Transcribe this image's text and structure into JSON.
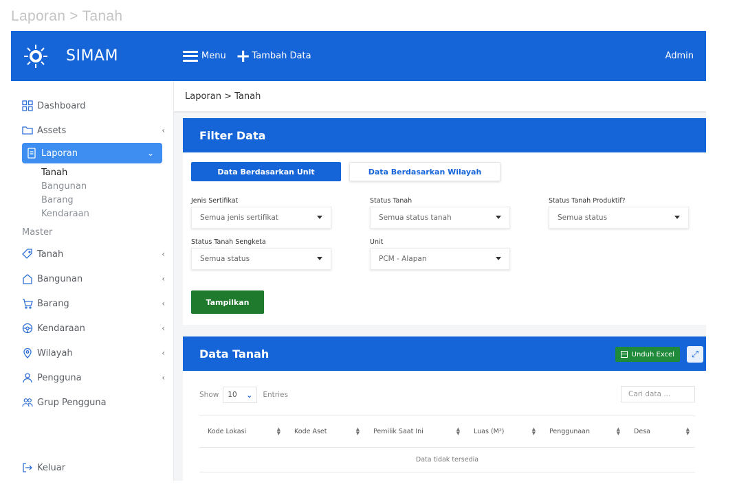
{
  "page_caption": "Laporan > Tanah",
  "brand": {
    "name": "SIMAM"
  },
  "topbar": {
    "menu_label": "Menu",
    "add_label": "Tambah Data",
    "user": "Admin"
  },
  "sidebar": {
    "items": [
      {
        "label": "Dashboard",
        "icon": "dashboard-icon"
      },
      {
        "label": "Assets",
        "icon": "folder-icon",
        "chevron": "‹"
      },
      {
        "label": "Laporan",
        "icon": "document-icon",
        "chevron": "⌄"
      }
    ],
    "laporan_sub": [
      "Tanah",
      "Bangunan",
      "Barang",
      "Kendaraan"
    ],
    "section_master": "Master",
    "master_items": [
      {
        "label": "Tanah",
        "icon": "tag-icon",
        "chevron": "‹"
      },
      {
        "label": "Bangunan",
        "icon": "home-icon",
        "chevron": "‹"
      },
      {
        "label": "Barang",
        "icon": "cart-icon",
        "chevron": "‹"
      },
      {
        "label": "Kendaraan",
        "icon": "steering-wheel-icon",
        "chevron": "‹"
      },
      {
        "label": "Wilayah",
        "icon": "location-pin-icon",
        "chevron": "‹"
      },
      {
        "label": "Pengguna",
        "icon": "user-icon",
        "chevron": "‹"
      },
      {
        "label": "Grup Pengguna",
        "icon": "users-icon"
      }
    ],
    "logout": "Keluar"
  },
  "breadcrumb": "Laporan > Tanah",
  "filter": {
    "title": "Filter Data",
    "tab_unit": "Data Berdasarkan Unit",
    "tab_wilayah": "Data Berdasarkan Wilayah",
    "fields": {
      "jenis_sertifikat": {
        "label": "Jenis Sertifikat",
        "value": "Semua jenis sertifikat"
      },
      "status_tanah": {
        "label": "Status Tanah",
        "value": "Semua status tanah"
      },
      "status_produktif": {
        "label": "Status Tanah Produktif?",
        "value": "Semua status"
      },
      "status_sengketa": {
        "label": "Status Tanah Sengketa",
        "value": "Semua status"
      },
      "unit": {
        "label": "Unit",
        "value": "PCM - Alapan"
      }
    },
    "submit": "Tampilkan"
  },
  "data": {
    "title": "Data Tanah",
    "excel": "Unduh Excel",
    "show_label": "Show",
    "entries_value": "10",
    "entries_label": "Entries",
    "search_placeholder": "Cari data ...",
    "columns": [
      "Kode Lokasi",
      "Kode Aset",
      "Pemilik Saat Ini",
      "Luas (M²)",
      "Penggunaan",
      "Desa"
    ],
    "empty": "Data tidak tersedia"
  },
  "colors": {
    "primary": "#1565d8",
    "active_nav": "#3d8ef0",
    "success": "#1f7a2e"
  }
}
